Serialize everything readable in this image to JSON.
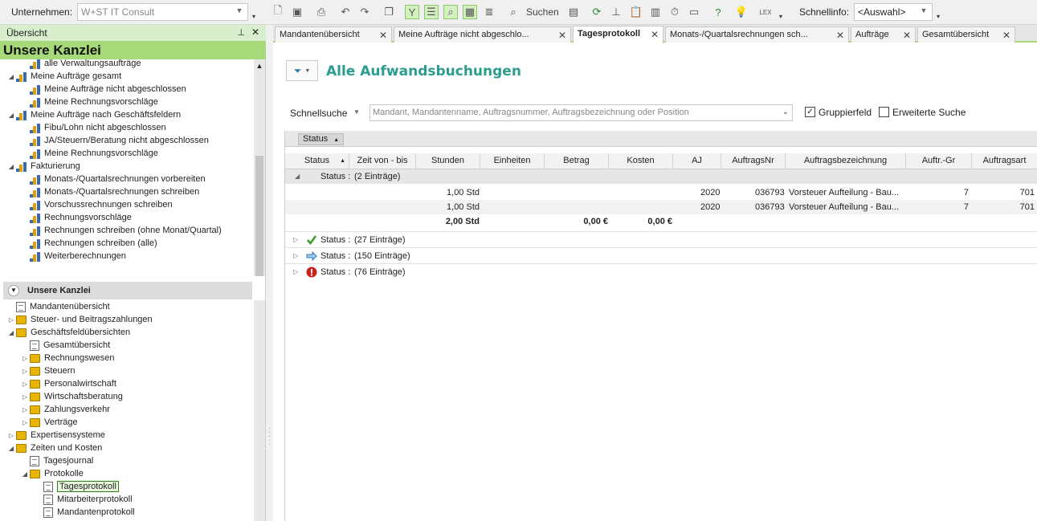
{
  "toolbar": {
    "company_label": "Unternehmen:",
    "company_value": "W+ST IT Consult",
    "search_label": "Suchen",
    "quickinfo_label": "Schnellinfo:",
    "quickinfo_value": "<Auswahl>"
  },
  "overview": {
    "header": "Übersicht",
    "title": "Unsere Kanzlei",
    "tree": [
      {
        "label": "alle Verwaltungsaufträge",
        "level": 2,
        "icon": "report",
        "exp": ""
      },
      {
        "label": "Meine Aufträge gesamt",
        "level": 1,
        "icon": "report",
        "exp": "◢"
      },
      {
        "label": "Meine Aufträge nicht abgeschlossen",
        "level": 2,
        "icon": "report",
        "exp": ""
      },
      {
        "label": "Meine Rechnungsvorschläge",
        "level": 2,
        "icon": "report",
        "exp": ""
      },
      {
        "label": "Meine Aufträge nach Geschäftsfeldern",
        "level": 1,
        "icon": "report",
        "exp": "◢"
      },
      {
        "label": "Fibu/Lohn nicht abgeschlossen",
        "level": 2,
        "icon": "report",
        "exp": ""
      },
      {
        "label": "JA/Steuern/Beratung nicht abgeschlossen",
        "level": 2,
        "icon": "report",
        "exp": ""
      },
      {
        "label": "Meine Rechnungsvorschläge",
        "level": 2,
        "icon": "report",
        "exp": ""
      },
      {
        "label": "Fakturierung",
        "level": 1,
        "icon": "report",
        "exp": "◢"
      },
      {
        "label": "Monats-/Quartalsrechnungen vorbereiten",
        "level": 2,
        "icon": "report",
        "exp": ""
      },
      {
        "label": "Monats-/Quartalsrechnungen schreiben",
        "level": 2,
        "icon": "report",
        "exp": ""
      },
      {
        "label": "Vorschussrechnungen schreiben",
        "level": 2,
        "icon": "report",
        "exp": ""
      },
      {
        "label": "Rechnungsvorschläge",
        "level": 2,
        "icon": "report",
        "exp": ""
      },
      {
        "label": "Rechnungen schreiben (ohne Monat/Quartal)",
        "level": 2,
        "icon": "report",
        "exp": ""
      },
      {
        "label": "Rechnungen schreiben (alle)",
        "level": 2,
        "icon": "report",
        "exp": ""
      },
      {
        "label": "Weiterberechnungen",
        "level": 2,
        "icon": "report",
        "exp": ""
      }
    ]
  },
  "kanzlei": {
    "header": "Unsere Kanzlei",
    "tree": [
      {
        "label": "Mandantenübersicht",
        "level": 1,
        "icon": "doc",
        "exp": ""
      },
      {
        "label": "Steuer- und Beitragszahlungen",
        "level": 1,
        "icon": "folder",
        "exp": "▷"
      },
      {
        "label": "Geschäftsfeldübersichten",
        "level": 1,
        "icon": "folder",
        "exp": "◢"
      },
      {
        "label": "Gesamtübersicht",
        "level": 2,
        "icon": "doc",
        "exp": ""
      },
      {
        "label": "Rechnungswesen",
        "level": 2,
        "icon": "folder",
        "exp": "▷"
      },
      {
        "label": "Steuern",
        "level": 2,
        "icon": "folder",
        "exp": "▷"
      },
      {
        "label": "Personalwirtschaft",
        "level": 2,
        "icon": "folder",
        "exp": "▷"
      },
      {
        "label": "Wirtschaftsberatung",
        "level": 2,
        "icon": "folder",
        "exp": "▷"
      },
      {
        "label": "Zahlungsverkehr",
        "level": 2,
        "icon": "folder",
        "exp": "▷"
      },
      {
        "label": "Verträge",
        "level": 2,
        "icon": "folder",
        "exp": "▷"
      },
      {
        "label": "Expertisensysteme",
        "level": 1,
        "icon": "folder",
        "exp": "▷"
      },
      {
        "label": "Zeiten und Kosten",
        "level": 1,
        "icon": "folder",
        "exp": "◢"
      },
      {
        "label": "Tagesjournal",
        "level": 2,
        "icon": "doc",
        "exp": ""
      },
      {
        "label": "Protokolle",
        "level": 2,
        "icon": "folder",
        "exp": "◢"
      },
      {
        "label": "Tagesprotokoll",
        "level": 3,
        "icon": "doc",
        "exp": "",
        "selected": true
      },
      {
        "label": "Mitarbeiterprotokoll",
        "level": 3,
        "icon": "doc",
        "exp": ""
      },
      {
        "label": "Mandantenprotokoll",
        "level": 3,
        "icon": "doc",
        "exp": ""
      }
    ]
  },
  "tabs": [
    {
      "label": "Mandantenübersicht"
    },
    {
      "label": "Meine Aufträge nicht abgeschlo..."
    },
    {
      "label": "Tagesprotokoll",
      "selected": true
    },
    {
      "label": "Monats-/Quartalsrechnungen sch..."
    },
    {
      "label": "Aufträge"
    },
    {
      "label": "Gesamtübersicht"
    }
  ],
  "main": {
    "title": "Alle Aufwandsbuchungen",
    "quicksearch_label": "Schnellsuche",
    "search_placeholder": "Mandant, Mandantenname, Auftragsnummer, Auftragsbezeichnung oder Position",
    "group_field_label": "Gruppierfeld",
    "group_field_checked": true,
    "extended_search_label": "Erweiterte Suche",
    "extended_search_checked": false,
    "group_chip": "Status",
    "columns": [
      "Status",
      "Zeit von - bis",
      "Stunden",
      "Einheiten",
      "Betrag",
      "Kosten",
      "AJ",
      "AuftragsNr",
      "Auftragsbezeichnung",
      "Auftr.-Gr",
      "Auftragsart"
    ],
    "expanded_group": {
      "label": "Status :",
      "count": "(2 Einträge)"
    },
    "rows": [
      {
        "stunden": "1,00 Std",
        "aj": "2020",
        "nr": "036793",
        "bez": "Vorsteuer Aufteilung - Bau...",
        "gr": "7",
        "art": "701"
      },
      {
        "stunden": "1,00 Std",
        "aj": "2020",
        "nr": "036793",
        "bez": "Vorsteuer Aufteilung - Bau...",
        "gr": "7",
        "art": "701"
      }
    ],
    "summary": {
      "stunden": "2,00 Std",
      "betrag": "0,00 €",
      "kosten": "0,00 €"
    },
    "groups": [
      {
        "label": "Status :",
        "count": "(27 Einträge)",
        "icon": "check-icon"
      },
      {
        "label": "Status :",
        "count": "(150 Einträge)",
        "icon": "arrow-right-icon"
      },
      {
        "label": "Status :",
        "count": "(76 Einträge)",
        "icon": "error-icon"
      }
    ]
  }
}
